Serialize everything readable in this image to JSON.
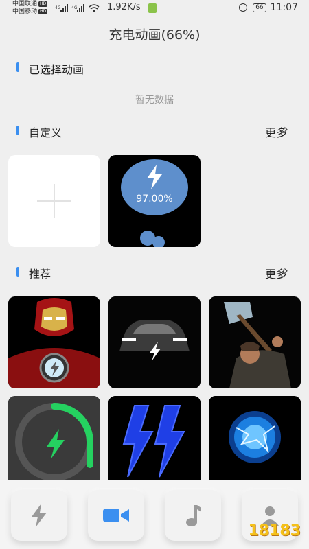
{
  "status_bar": {
    "carrier1": "中国联通",
    "carrier2": "中国移动",
    "hd": "HD",
    "net_speed": "1.92K/s",
    "battery": "66",
    "time": "11:07"
  },
  "title": "充电动画(66%)",
  "selected_section": {
    "title": "已选择动画",
    "empty_text": "暂无数据"
  },
  "custom_section": {
    "title": "自定义",
    "more": "更多"
  },
  "custom_preview": {
    "percent": "97.00%"
  },
  "recommend_section": {
    "title": "推荐",
    "more": "更多"
  },
  "recommend_items": [
    "iron-man",
    "car-lightning",
    "thor",
    "green-ring",
    "blue-bolt",
    "plasma-ball"
  ],
  "colors": {
    "accent": "#3b8ff0",
    "bubble": "#5e8fcc",
    "green": "#25d160"
  },
  "bottom_nav": [
    "lightning-icon",
    "video-icon",
    "music-icon",
    "user-icon"
  ],
  "watermark": "18183"
}
